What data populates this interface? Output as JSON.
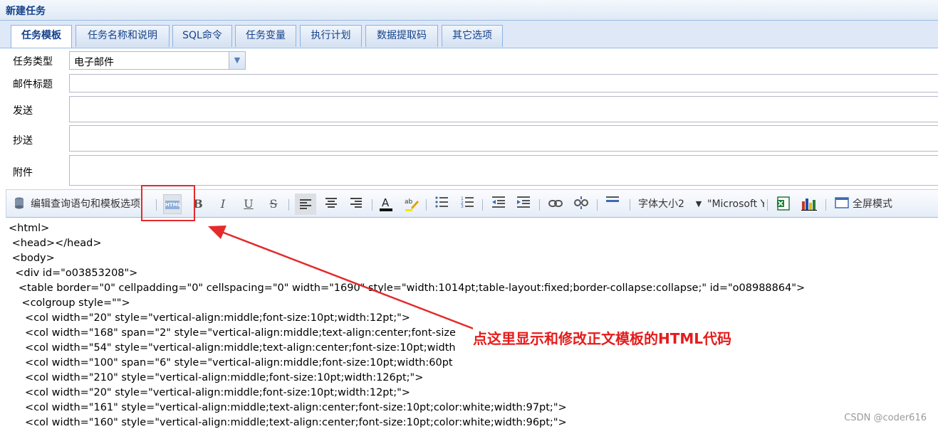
{
  "window": {
    "title": "新建任务"
  },
  "tabs": [
    {
      "label": "任务模板",
      "active": true
    },
    {
      "label": "任务名称和说明"
    },
    {
      "label": "SQL命令"
    },
    {
      "label": "任务变量"
    },
    {
      "label": "执行计划"
    },
    {
      "label": "数据提取码"
    },
    {
      "label": "其它选项"
    }
  ],
  "form": {
    "task_type_label": "任务类型",
    "task_type_value": "电子邮件",
    "subject_label": "邮件标题",
    "to_label": "发送",
    "cc_label": "抄送",
    "attach_label": "附件"
  },
  "toolbar": {
    "edit_query_label": "编辑查询语句和模板选项",
    "html_icon": "HTML",
    "bold": "B",
    "italic": "I",
    "underline": "U",
    "strike": "S",
    "font_size_label": "字体大小2",
    "font_name": "\"Microsoft Ya",
    "fullscreen_label": "全屏模式"
  },
  "editor": {
    "lines": [
      "<html>",
      " <head></head>",
      " <body>",
      "  <div id=\"o03853208\">",
      "   <table border=\"0\" cellpadding=\"0\" cellspacing=\"0\" width=\"1690\" style=\"width:1014pt;table-layout:fixed;border-collapse:collapse;\" id=\"o08988864\">",
      "    <colgroup style=\"\">",
      "     <col width=\"20\" style=\"vertical-align:middle;font-size:10pt;width:12pt;\">",
      "     <col width=\"168\" span=\"2\" style=\"vertical-align:middle;text-align:center;font-size",
      "     <col width=\"54\" style=\"vertical-align:middle;text-align:center;font-size:10pt;width",
      "     <col width=\"100\" span=\"6\" style=\"vertical-align:middle;font-size:10pt;width:60pt",
      "     <col width=\"210\" style=\"vertical-align:middle;font-size:10pt;width:126pt;\">",
      "     <col width=\"20\" style=\"vertical-align:middle;font-size:10pt;width:12pt;\">",
      "     <col width=\"161\" style=\"vertical-align:middle;text-align:center;font-size:10pt;color:white;width:97pt;\">",
      "     <col width=\"160\" style=\"vertical-align:middle;text-align:center;font-size:10pt;color:white;width:96pt;\">"
    ]
  },
  "annotation": {
    "text": "点这里显示和修改正文模板的HTML代码",
    "color": "#e61b1b"
  },
  "watermark": "CSDN @coder616",
  "colors": {
    "accent": "#15428b",
    "tab_border": "#8db2e3",
    "annotation_red": "#e42a2a"
  }
}
